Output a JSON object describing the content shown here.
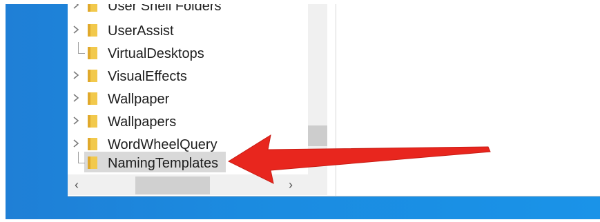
{
  "tree": {
    "items": [
      {
        "label": "User Shell Folders",
        "expandable": true,
        "partial": true
      },
      {
        "label": "UserAssist",
        "expandable": true
      },
      {
        "label": "VirtualDesktops",
        "expandable": false
      },
      {
        "label": "VisualEffects",
        "expandable": true
      },
      {
        "label": "Wallpaper",
        "expandable": true
      },
      {
        "label": "Wallpapers",
        "expandable": true
      },
      {
        "label": "WordWheelQuery",
        "expandable": true
      },
      {
        "label": "NamingTemplates",
        "expandable": false,
        "selected": true
      }
    ]
  },
  "scrollbar": {
    "left_arrow": "‹",
    "right_arrow": "›"
  },
  "colors": {
    "desktop": "#1b8be0",
    "folder": "#f2c94c",
    "selection": "#d9d9d9",
    "annotation_arrow": "#e8261e"
  },
  "annotation": {
    "icon": "red-arrow-pointer"
  }
}
